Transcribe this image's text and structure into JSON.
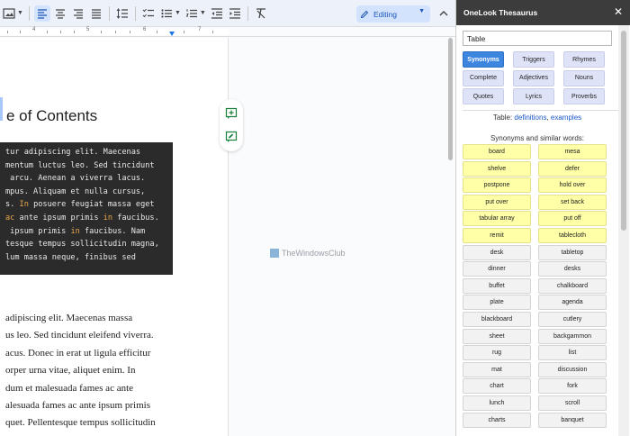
{
  "toolbar": {
    "editing_label": "Editing"
  },
  "ruler": {
    "numbers": [
      "4",
      "5",
      "6",
      "7"
    ]
  },
  "document": {
    "heading": "e of Contents",
    "code_lines": [
      [
        {
          "t": "tur adipiscing elit. Maecenas"
        }
      ],
      [
        {
          "t": "mentum luctus leo. Sed tincidunt"
        }
      ],
      [
        {
          "t": " arcu. Aenean a viverra lacus."
        }
      ],
      [
        {
          "t": "mpus. Aliquam et nulla cursus,"
        }
      ],
      [
        {
          "t": "s. "
        },
        {
          "t": "In",
          "k": true
        },
        {
          "t": " posuere feugiat massa eget"
        }
      ],
      [
        {
          "t": "ac",
          "k": true
        },
        {
          "t": " ante ipsum primis "
        },
        {
          "t": "in",
          "k": true
        },
        {
          "t": " faucibus."
        }
      ],
      [
        {
          "t": " ipsum primis "
        },
        {
          "t": "in",
          "k": true
        },
        {
          "t": " faucibus. Nam"
        }
      ],
      [
        {
          "t": "tesque tempus sollicitudin magna,"
        }
      ],
      [
        {
          "t": "lum massa neque, finibus sed"
        }
      ]
    ],
    "body_lines": [
      "adipiscing elit. Maecenas massa",
      "us leo. Sed tincidunt eleifend viverra.",
      "acus. Donec in erat ut ligula efficitur",
      "orper urna vitae, aliquet enim. In",
      "dum et malesuada fames ac ante",
      "alesuada fames ac ante ipsum primis",
      "quet. Pellentesque tempus sollicitudin"
    ],
    "watermark": "TheWindowsClub"
  },
  "thesaurus": {
    "title": "OneLook Thesaurus",
    "close_label": "✕",
    "search_value": "Table",
    "modes": [
      "Synonyms",
      "Triggers",
      "Rhymes",
      "Complete",
      "Adjectives",
      "Nouns",
      "Quotes",
      "Lyrics",
      "Proverbs"
    ],
    "active_mode": "Synonyms",
    "table_prefix": "Table: ",
    "definitions_link": "definitions",
    "separator": ", ",
    "examples_link": "examples",
    "synonyms_title": "Synonyms and similar words:",
    "words_left": [
      "board",
      "shelve",
      "postpone",
      "put over",
      "tabular array",
      "remit",
      "desk",
      "dinner",
      "buffet",
      "plate",
      "blackboard",
      "sheet",
      "rug",
      "mat",
      "chart",
      "lunch",
      "charts"
    ],
    "words_right": [
      "mesa",
      "defer",
      "hold over",
      "set back",
      "put off",
      "tablecloth",
      "tabletop",
      "desks",
      "chalkboard",
      "agenda",
      "cutlery",
      "backgammon",
      "list",
      "discussion",
      "fork",
      "scroll",
      "banquet"
    ],
    "highlight_rows": 6,
    "highlight_color": "#ffffa8",
    "active_color": "#3d86e0"
  }
}
